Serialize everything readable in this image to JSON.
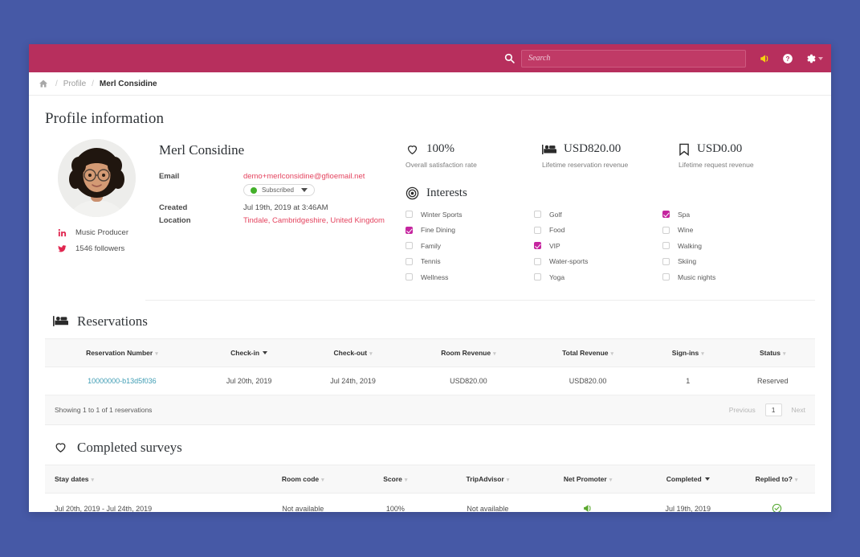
{
  "colors": {
    "desktop_blue": "#4659a6",
    "header_pink": "#b72f5d",
    "accent_red": "#e4445f",
    "link_teal": "#3f9db4",
    "check_magenta": "#c5259f",
    "status_green": "#43b02a",
    "megaphone_yellow": "#f5d40e"
  },
  "topbar": {
    "search_placeholder": "Search",
    "search_value": "",
    "icons": [
      "search-icon",
      "megaphone-icon",
      "help-icon",
      "gear-icon"
    ]
  },
  "breadcrumb": {
    "home": "home-icon",
    "sep": "/",
    "parent": "Profile",
    "current": "Merl Considine"
  },
  "profile": {
    "section_title": "Profile information",
    "name": "Merl Considine",
    "avatar_alt": "profile-photo",
    "socials": [
      {
        "icon": "linkedin-icon",
        "text": "Music Producer"
      },
      {
        "icon": "twitter-icon",
        "text": "1546 followers"
      }
    ],
    "fields": [
      {
        "label": "Email",
        "value": "demo+merlconsidine@gfioemail.net"
      },
      {
        "label": "Created",
        "value": "Jul 19th, 2019 at 3:46AM"
      },
      {
        "label": "Location",
        "value": "Tindale, Cambridgeshire, United Kingdom"
      }
    ],
    "subscription": {
      "status": "Subscribed",
      "dot_color": "#43b02a"
    }
  },
  "stats": [
    {
      "icon": "heart-icon",
      "value": "100%",
      "label": "Overall satisfaction rate"
    },
    {
      "icon": "bed-icon",
      "value": "USD820.00",
      "label": "Lifetime reservation revenue"
    },
    {
      "icon": "bookmark-icon",
      "value": "USD0.00",
      "label": "Lifetime request revenue"
    }
  ],
  "interests": {
    "icon": "target-icon",
    "title": "Interests",
    "columns": [
      [
        {
          "label": "Winter Sports",
          "checked": false
        },
        {
          "label": "Fine Dining",
          "checked": true
        },
        {
          "label": "Family",
          "checked": false
        },
        {
          "label": "Tennis",
          "checked": false
        },
        {
          "label": "Wellness",
          "checked": false
        }
      ],
      [
        {
          "label": "Golf",
          "checked": false
        },
        {
          "label": "Food",
          "checked": false
        },
        {
          "label": "VIP",
          "checked": true
        },
        {
          "label": "Water-sports",
          "checked": false
        },
        {
          "label": "Yoga",
          "checked": false
        }
      ],
      [
        {
          "label": "Spa",
          "checked": true
        },
        {
          "label": "Wine",
          "checked": false
        },
        {
          "label": "Walking",
          "checked": false
        },
        {
          "label": "Skiing",
          "checked": false
        },
        {
          "label": "Music nights",
          "checked": false
        }
      ]
    ]
  },
  "reservations": {
    "icon": "bed-icon",
    "title": "Reservations",
    "headers": [
      {
        "label": "Reservation Number",
        "sort": "none"
      },
      {
        "label": "Check-in",
        "sort": "desc"
      },
      {
        "label": "Check-out",
        "sort": "none"
      },
      {
        "label": "Room Revenue",
        "sort": "none"
      },
      {
        "label": "Total Revenue",
        "sort": "none"
      },
      {
        "label": "Sign-ins",
        "sort": "none"
      },
      {
        "label": "Status",
        "sort": "none"
      }
    ],
    "rows": [
      {
        "number": "10000000-b13d5f036",
        "checkin": "Jul 20th, 2019",
        "checkout": "Jul 24th, 2019",
        "room_revenue": "USD820.00",
        "total_revenue": "USD820.00",
        "signins": "1",
        "status": "Reserved"
      }
    ],
    "footer_count": "Showing 1 to 1 of 1 reservations",
    "pager": {
      "previous": "Previous",
      "current": "1",
      "next": "Next"
    }
  },
  "surveys": {
    "icon": "heart-icon",
    "title": "Completed surveys",
    "headers": [
      {
        "label": "Stay dates",
        "sort": "none"
      },
      {
        "label": "Room code",
        "sort": "none"
      },
      {
        "label": "Score",
        "sort": "none"
      },
      {
        "label": "TripAdvisor",
        "sort": "none"
      },
      {
        "label": "Net Promoter",
        "sort": "none"
      },
      {
        "label": "Completed",
        "sort": "desc"
      },
      {
        "label": "Replied to?",
        "sort": "none"
      }
    ],
    "rows": [
      {
        "stay_dates": "Jul 20th, 2019 - Jul 24th, 2019",
        "room_code": "Not available",
        "score": "100%",
        "tripadvisor": "Not available",
        "net_promoter_icon": "megaphone-icon",
        "completed": "Jul 19th, 2019",
        "replied_icon": "check-circle-icon"
      }
    ]
  }
}
